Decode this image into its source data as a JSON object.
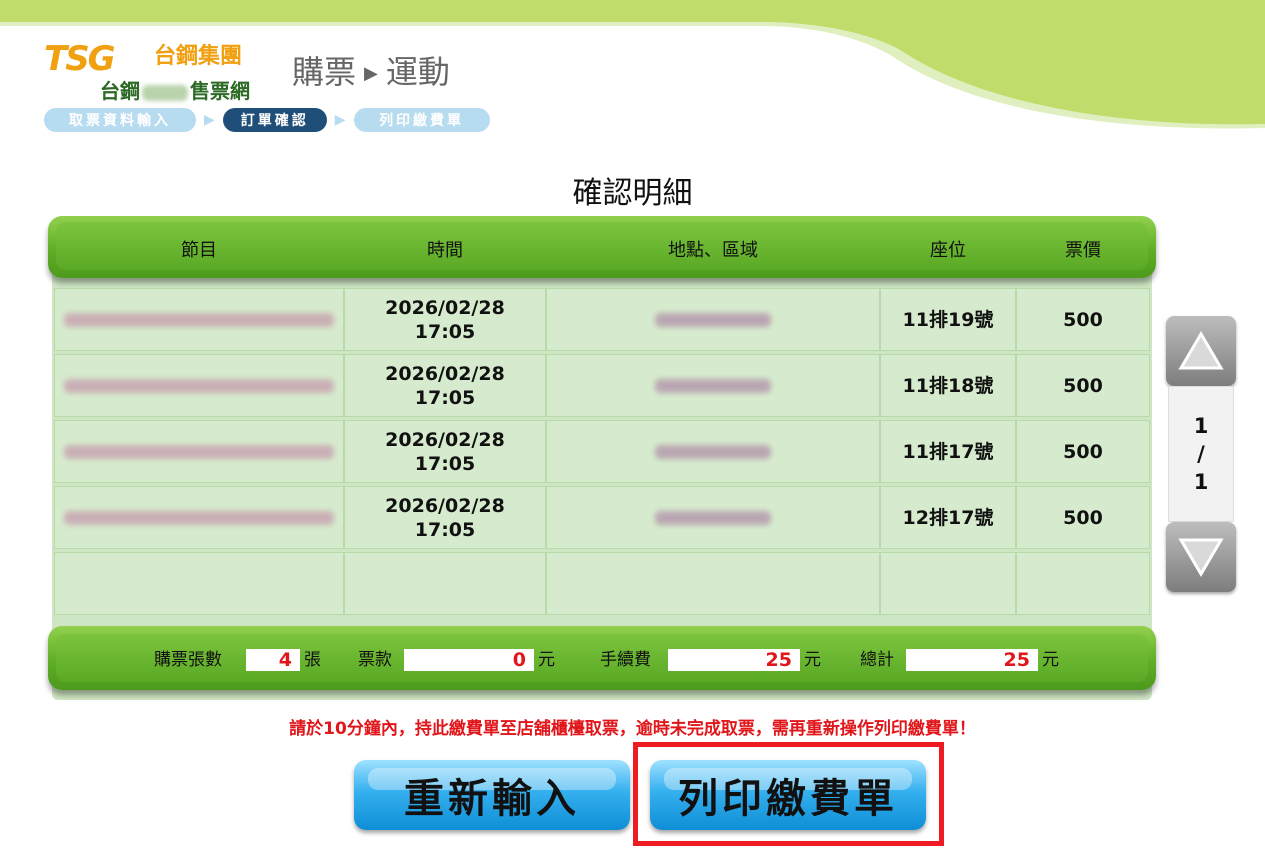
{
  "logo": {
    "brand": "TSG",
    "group": "台鋼集團",
    "sub_left": "台鋼",
    "sub_right": "售票網"
  },
  "breadcrumb": {
    "first": "購票",
    "sep": "▶",
    "second": "運動"
  },
  "steps": [
    {
      "label": "取票資料輸入",
      "state": "done"
    },
    {
      "label": "訂單確認",
      "state": "active"
    },
    {
      "label": "列印繳費單",
      "state": "pending"
    }
  ],
  "section_title": "確認明細",
  "table": {
    "headers": [
      "節目",
      "時間",
      "地點、區域",
      "座位",
      "票價"
    ],
    "rows": [
      {
        "date": "2026/02/28",
        "time": "17:05",
        "seat": "11排19號",
        "price": "500"
      },
      {
        "date": "2026/02/28",
        "time": "17:05",
        "seat": "11排18號",
        "price": "500"
      },
      {
        "date": "2026/02/28",
        "time": "17:05",
        "seat": "11排17號",
        "price": "500"
      },
      {
        "date": "2026/02/28",
        "time": "17:05",
        "seat": "12排17號",
        "price": "500"
      }
    ]
  },
  "summary": {
    "count_label": "購票張數",
    "count": "4",
    "count_unit": "張",
    "ticket_label": "票款",
    "ticket": "0",
    "ticket_unit": "元",
    "fee_label": "手續費",
    "fee": "25",
    "fee_unit": "元",
    "total_label": "總計",
    "total": "25",
    "total_unit": "元"
  },
  "pager": {
    "current": "1",
    "sep": "/",
    "total": "1"
  },
  "notice": "請於10分鐘內，持此繳費單至店舖櫃檯取票，逾時未完成取票，需再重新操作列印繳費單！",
  "buttons": {
    "reenter": "重新輸入",
    "print": "列印繳費單"
  },
  "colors": {
    "green": "#5fae27",
    "table_bg": "#d6ebcd",
    "red": "#e0161b",
    "blue_button": "#35b0ef",
    "highlight": "#ee1b22"
  }
}
